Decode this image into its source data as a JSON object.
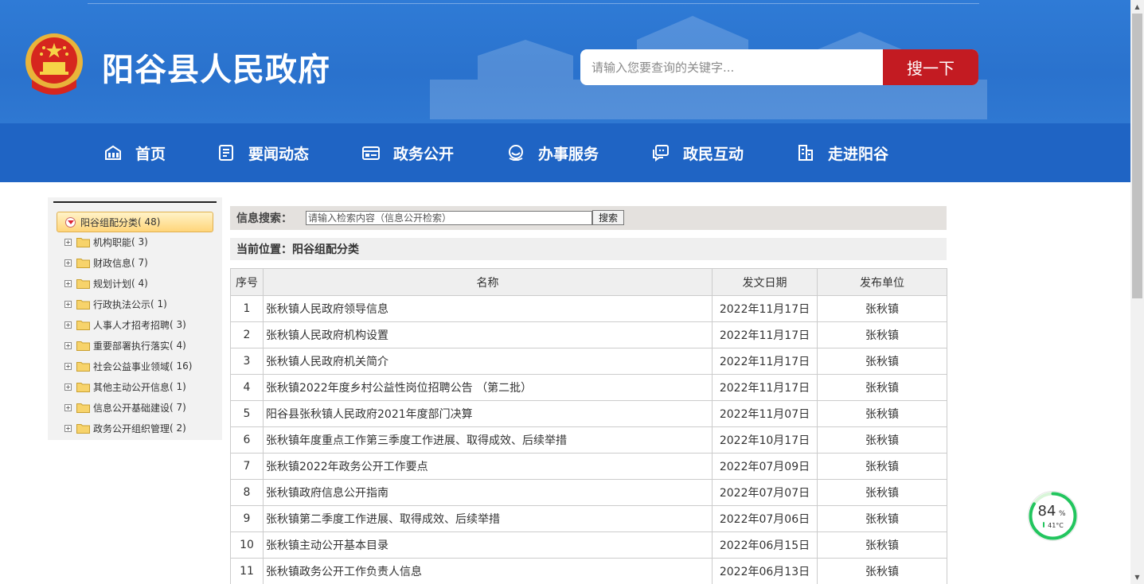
{
  "header": {
    "site_title": "阳谷县人民政府",
    "search_placeholder": "请输入您要查询的关键字...",
    "search_button": "搜一下"
  },
  "nav": {
    "items": [
      {
        "label": "首页",
        "icon": "home-icon"
      },
      {
        "label": "要闻动态",
        "icon": "news-icon"
      },
      {
        "label": "政务公开",
        "icon": "id-card-icon"
      },
      {
        "label": "办事服务",
        "icon": "service-icon"
      },
      {
        "label": "政民互动",
        "icon": "chat-icon"
      },
      {
        "label": "走进阳谷",
        "icon": "building-icon"
      }
    ]
  },
  "sidebar": {
    "root": {
      "label": "阳谷组配分类",
      "count": "( 48)"
    },
    "items": [
      {
        "label": "机构职能",
        "count": "( 3)"
      },
      {
        "label": "财政信息",
        "count": "( 7)"
      },
      {
        "label": "规划计划",
        "count": "( 4)"
      },
      {
        "label": "行政执法公示",
        "count": "( 1)"
      },
      {
        "label": "人事人才招考招聘",
        "count": "( 3)"
      },
      {
        "label": "重要部署执行落实",
        "count": "( 4)"
      },
      {
        "label": "社会公益事业领域",
        "count": "( 16)"
      },
      {
        "label": "其他主动公开信息",
        "count": "( 1)"
      },
      {
        "label": "信息公开基础建设",
        "count": "( 7)"
      },
      {
        "label": "政务公开组织管理",
        "count": "( 2)"
      }
    ]
  },
  "info_search": {
    "label": "信息搜索：",
    "placeholder": "请输入检索内容（信息公开检索）",
    "button": "搜索"
  },
  "breadcrumb": "当前位置：阳谷组配分类",
  "table": {
    "headers": [
      "序号",
      "名称",
      "发文日期",
      "发布单位"
    ],
    "rows": [
      {
        "num": "1",
        "name": "张秋镇人民政府领导信息",
        "date": "2022年11月17日",
        "unit": "张秋镇"
      },
      {
        "num": "2",
        "name": "张秋镇人民政府机构设置",
        "date": "2022年11月17日",
        "unit": "张秋镇"
      },
      {
        "num": "3",
        "name": "张秋镇人民政府机关简介",
        "date": "2022年11月17日",
        "unit": "张秋镇"
      },
      {
        "num": "4",
        "name": "张秋镇2022年度乡村公益性岗位招聘公告 （第二批）",
        "date": "2022年11月17日",
        "unit": "张秋镇"
      },
      {
        "num": "5",
        "name": "阳谷县张秋镇人民政府2021年度部门决算",
        "date": "2022年11月07日",
        "unit": "张秋镇"
      },
      {
        "num": "6",
        "name": "张秋镇年度重点工作第三季度工作进展、取得成效、后续举措",
        "date": "2022年10月17日",
        "unit": "张秋镇"
      },
      {
        "num": "7",
        "name": "张秋镇2022年政务公开工作要点",
        "date": "2022年07月09日",
        "unit": "张秋镇"
      },
      {
        "num": "8",
        "name": "张秋镇政府信息公开指南",
        "date": "2022年07月07日",
        "unit": "张秋镇"
      },
      {
        "num": "9",
        "name": "张秋镇第二季度工作进展、取得成效、后续举措",
        "date": "2022年07月06日",
        "unit": "张秋镇"
      },
      {
        "num": "10",
        "name": "张秋镇主动公开基本目录",
        "date": "2022年06月15日",
        "unit": "张秋镇"
      },
      {
        "num": "11",
        "name": "张秋镇政务公开工作负责人信息",
        "date": "2022年06月13日",
        "unit": "张秋镇"
      }
    ]
  },
  "widget": {
    "percent": "84",
    "percent_sign": "%",
    "temp": "41°C",
    "level": 0.84
  }
}
